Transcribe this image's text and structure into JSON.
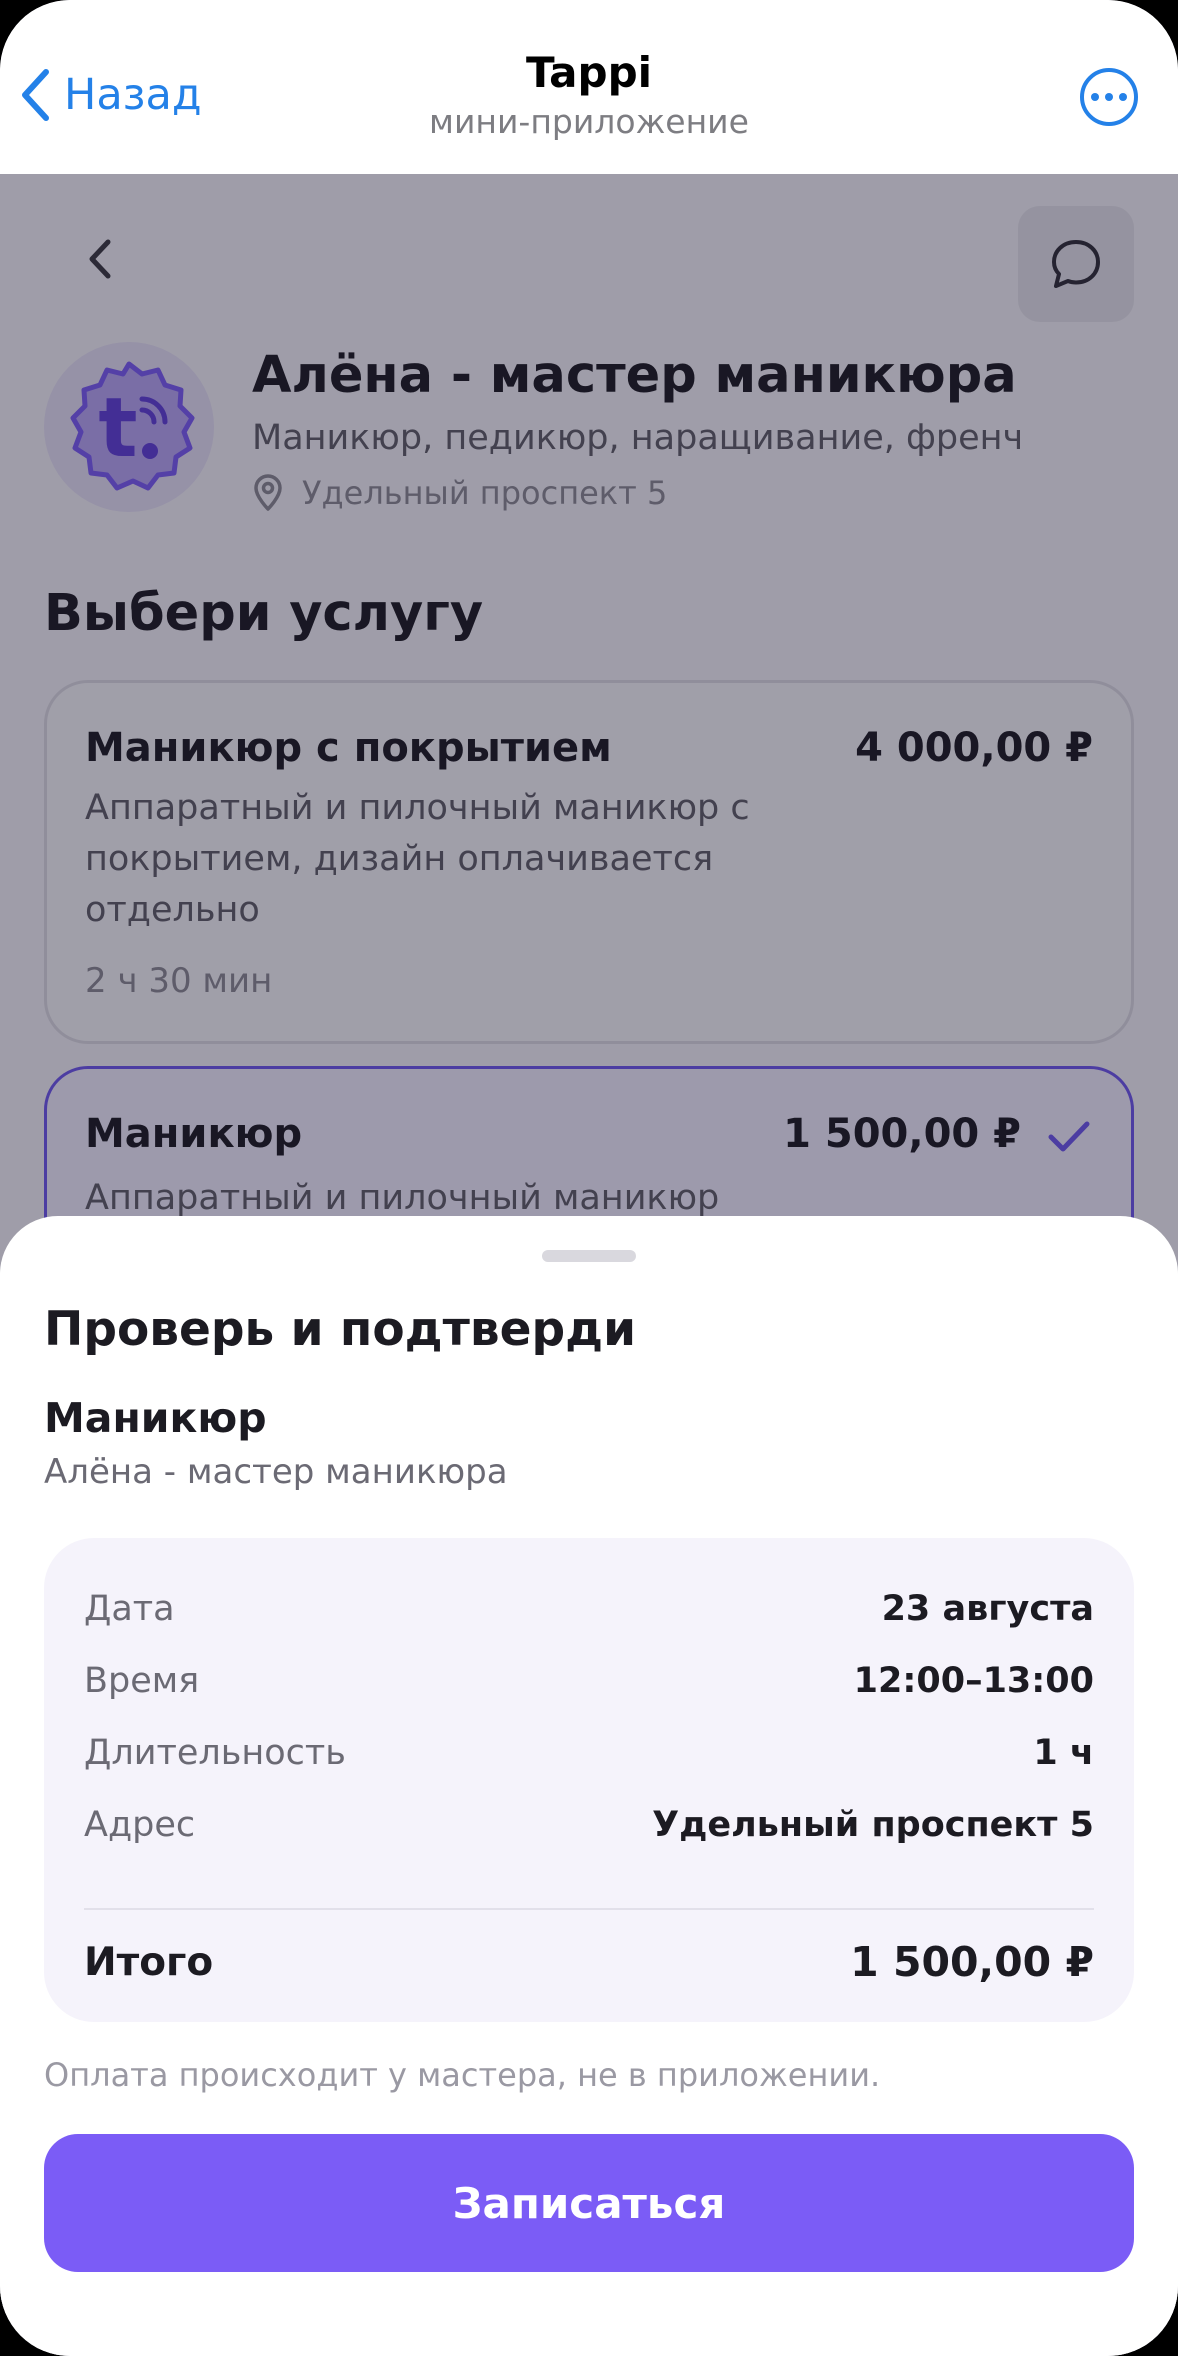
{
  "telegram_bar": {
    "back_label": "Назад",
    "title": "Tappi",
    "subtitle": "мини-приложение"
  },
  "master": {
    "name": "Алёна - мастер маникюра",
    "description": "Маникюр, педикюр, наращивание, френч",
    "address": "Удельный проспект 5"
  },
  "services_section": {
    "title": "Выбери услугу",
    "items": [
      {
        "name": "Маникюр с покрытием",
        "price": "4 000,00 ₽",
        "description": "Аппаратный и пилочный маникюр с покрытием, дизайн оплачивается отдельно",
        "duration": "2 ч 30 мин",
        "selected": false
      },
      {
        "name": "Маникюр",
        "price": "1 500,00 ₽",
        "description": "Аппаратный и пилочный маникюр",
        "selected": true
      }
    ]
  },
  "confirm_sheet": {
    "title": "Проверь и подтверди",
    "service_name": "Маникюр",
    "master_name": "Алёна - мастер маникюра",
    "details": [
      {
        "label": "Дата",
        "value": "23 августа"
      },
      {
        "label": "Время",
        "value": "12:00–13:00"
      },
      {
        "label": "Длительность",
        "value": "1 ч"
      },
      {
        "label": "Адрес",
        "value": "Удельный проспект 5"
      }
    ],
    "total_label": "Итого",
    "total_value": "1 500,00 ₽",
    "payment_note": "Оплата происходит у мастера, не в приложении.",
    "submit_label": "Записаться"
  },
  "colors": {
    "accent": "#7b5cf6",
    "telegram_blue": "#2481e8",
    "text_primary": "#1c1b22"
  },
  "icons": [
    "chevron-left-icon",
    "more-icon",
    "chat-bubble-icon",
    "location-pin-icon",
    "checkmark-icon",
    "tappi-logo"
  ]
}
